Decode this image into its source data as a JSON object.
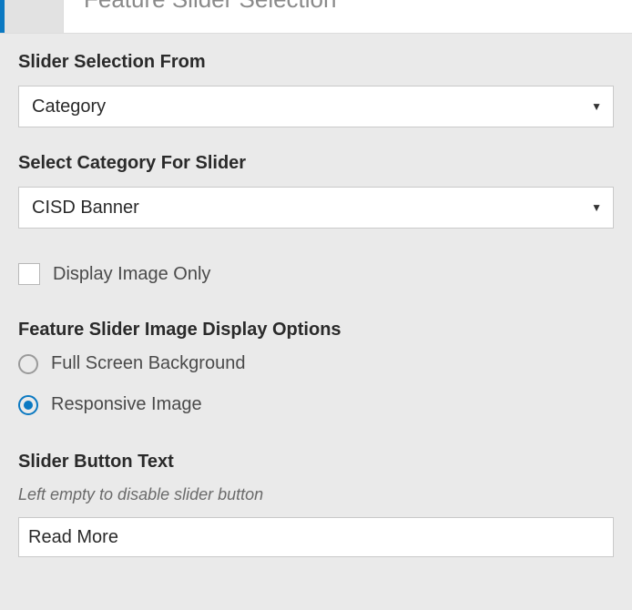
{
  "header": {
    "title": "Feature Slider Selection"
  },
  "slider_from": {
    "label": "Slider Selection From",
    "value": "Category"
  },
  "category": {
    "label": "Select Category For Slider",
    "value": "CISD Banner"
  },
  "display_image_only": {
    "label": "Display Image Only",
    "checked": false
  },
  "display_options": {
    "label": "Feature Slider Image Display Options",
    "options": [
      {
        "label": "Full Screen Background",
        "selected": false
      },
      {
        "label": "Responsive Image",
        "selected": true
      }
    ]
  },
  "button_text": {
    "label": "Slider Button Text",
    "help": "Left empty to disable slider button",
    "value": "Read More"
  }
}
